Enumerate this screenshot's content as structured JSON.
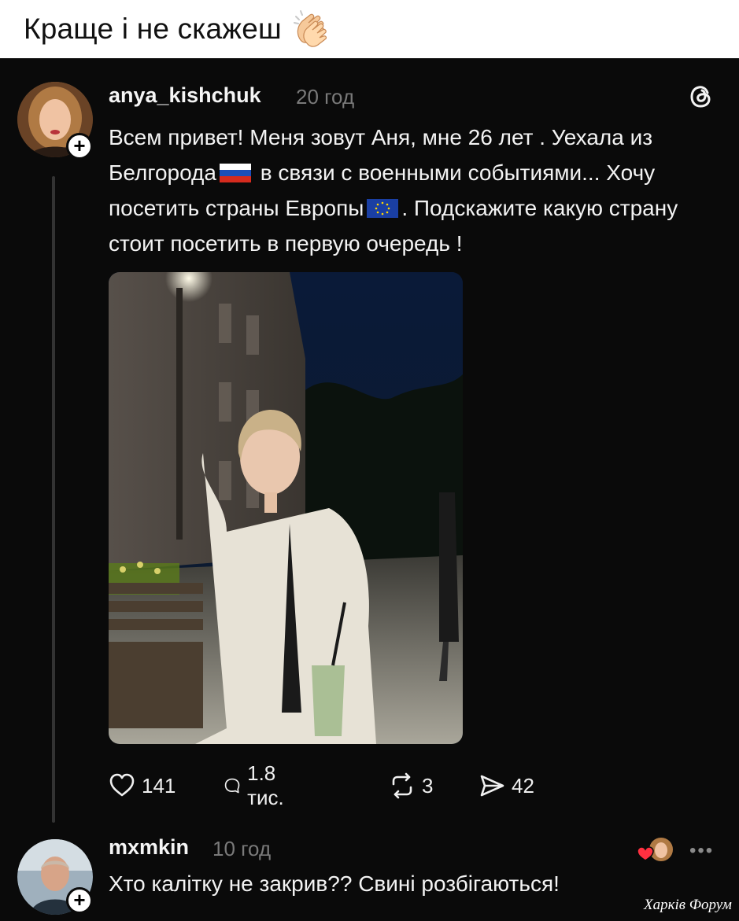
{
  "caption": {
    "text": "Краще і не скажеш"
  },
  "post": {
    "username": "anya_kishchuk",
    "time": "20 год",
    "text_part1": "Всем привет! Меня зовут Аня, мне 26 лет . Уехала из Белгорода",
    "text_part2": " в связи с военными событиями... Хочу посетить страны Европы",
    "text_part3": ". Подскажите какую страну стоит посетить в первую очередь !",
    "stats": {
      "likes": "141",
      "comments": "1.8 тис.",
      "reposts": "3",
      "shares": "42"
    }
  },
  "reply": {
    "username": "mxmkin",
    "time": "10 год",
    "text": "Хто калітку не закрив?? Свині розбігаються!",
    "more_label": "•••"
  },
  "watermark": {
    "text": "Харків Форум"
  },
  "icons": {
    "clap": "clapping-hands-icon",
    "threads": "threads-logo-icon",
    "like": "heart-icon",
    "comment": "comment-bubble-icon",
    "repost": "repost-icon",
    "share": "share-send-icon",
    "flag_russia": "russia-flag-icon",
    "flag_eu": "eu-flag-icon"
  },
  "colors": {
    "background": "#0a0a0a",
    "text": "#f3f3f3",
    "muted": "#7a7a7a",
    "heart": "#ff3040"
  }
}
